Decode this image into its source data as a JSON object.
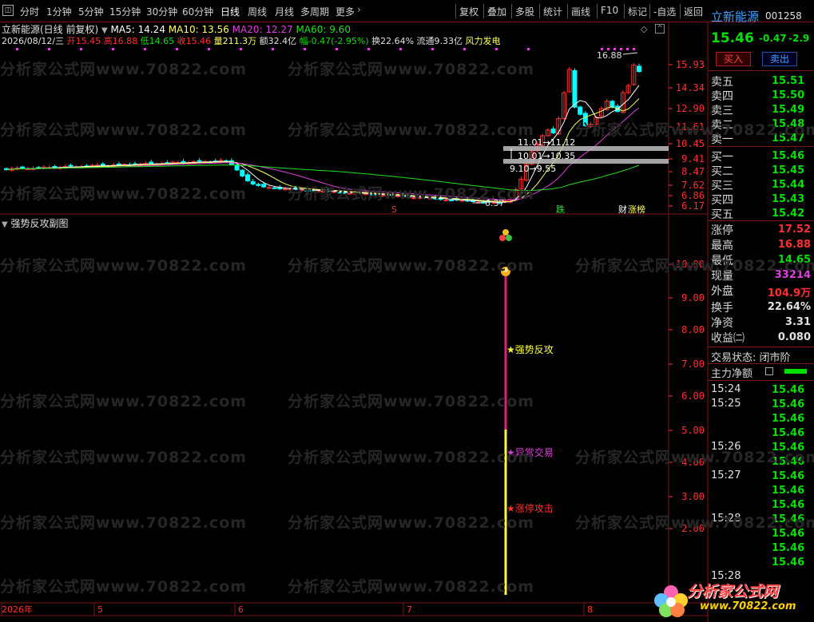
{
  "toolbar": {
    "tabs": [
      "分时",
      "1分钟",
      "5分钟",
      "15分钟",
      "30分钟",
      "60分钟",
      "日线",
      "周线",
      "月线",
      "多周期",
      "更多"
    ],
    "right": [
      "复权",
      "叠加",
      "多股",
      "统计",
      "画线",
      "F10",
      "标记",
      "-自选",
      "返回"
    ]
  },
  "stock": {
    "name": "立新能源",
    "code": "001258",
    "price": "15.46",
    "change": "-0.47",
    "pct": "-2.9"
  },
  "chart_header": {
    "title": "立新能源(日线 前复权)",
    "ma5": "MA5: 14.24",
    "ma10": "MA10: 13.56",
    "ma20": "MA20: 12.27",
    "ma60": "MA60: 9.60"
  },
  "info_line": [
    "2026/08/12/三",
    "开15.45",
    "高16.88",
    "低14.65",
    "收15.46",
    "量211.3万",
    "额32.4亿",
    "幅-0.47(-2.95%)",
    "换22.64%",
    "流通9.33亿",
    "风力发电"
  ],
  "main_axis": [
    "15.93",
    "14.34",
    "12.90",
    "11.61",
    "10.45",
    "9.41",
    "8.47",
    "7.62",
    "6.86",
    "6.17"
  ],
  "annotations": {
    "high": "16.88",
    "low": "6.37",
    "a1": "11.01→11.12",
    "a2": "10.01→10.35",
    "a3": "9.10→9.55",
    "mark_s": "S",
    "mark_die": "跌",
    "mark_cai": "财",
    "mark_zhang": "涨榜"
  },
  "subchart": {
    "title": "强势反攻副图",
    "axis": [
      "10.00",
      "9.00",
      "8.00",
      "7.00",
      "6.00",
      "5.00",
      "4.00",
      "3.00",
      "2.00"
    ],
    "label1": "强势反攻",
    "label2": "异常交易",
    "label3": "涨停攻击"
  },
  "dates": [
    "2026年",
    "5",
    "6",
    "7",
    "8"
  ],
  "right_panel": {
    "buy_btn": "买入",
    "sell_btn": "卖出",
    "asks": [
      {
        "label": "卖五",
        "price": "15.51"
      },
      {
        "label": "卖四",
        "price": "15.50"
      },
      {
        "label": "卖三",
        "price": "15.49"
      },
      {
        "label": "卖二",
        "price": "15.48"
      },
      {
        "label": "卖一",
        "price": "15.47"
      }
    ],
    "bids": [
      {
        "label": "买一",
        "price": "15.46"
      },
      {
        "label": "买二",
        "price": "15.45"
      },
      {
        "label": "买三",
        "price": "15.44"
      },
      {
        "label": "买四",
        "price": "15.43"
      },
      {
        "label": "买五",
        "price": "15.42"
      }
    ],
    "stats": [
      {
        "label": "涨停",
        "value": "17.52",
        "color": "#ff3030"
      },
      {
        "label": "最高",
        "value": "16.88",
        "color": "#ff3030"
      },
      {
        "label": "最低",
        "value": "14.65",
        "color": "#00e000"
      },
      {
        "label": "现量",
        "value": "33214",
        "color": "#e040e0"
      },
      {
        "label": "外盘",
        "value": "104.9万",
        "color": "#ff3030"
      },
      {
        "label": "换手",
        "value": "22.64%",
        "color": "#e0e0e0"
      },
      {
        "label": "净资",
        "value": "3.31",
        "color": "#e0e0e0"
      },
      {
        "label": "收益㈡",
        "value": "0.080",
        "color": "#e0e0e0"
      }
    ],
    "trade_state": "交易状态: 闭市阶",
    "main_net": "主力净额",
    "ticks": [
      {
        "time": "15:24",
        "price": "15.46"
      },
      {
        "time": "15:25",
        "price": "15.46"
      },
      {
        "time": "",
        "price": "15.46"
      },
      {
        "time": "",
        "price": "15.46"
      },
      {
        "time": "15:26",
        "price": "15.46"
      },
      {
        "time": "",
        "price": "15.46"
      },
      {
        "time": "15:27",
        "price": "15.46"
      },
      {
        "time": "",
        "price": "15.46"
      },
      {
        "time": "",
        "price": "15.46"
      },
      {
        "time": "15:28",
        "price": "15.46"
      },
      {
        "time": "",
        "price": "15.46"
      },
      {
        "time": "",
        "price": "15.46"
      },
      {
        "time": "",
        "price": "15.46"
      },
      {
        "time": "15:28",
        "price": ""
      }
    ]
  },
  "watermark": {
    "text": "分析家公式网www.70822.com",
    "logo": "分析家公式网",
    "logo_url": "www.70822.com"
  },
  "colors": {
    "up": "#ff3030",
    "down": "#00ffff",
    "ma5": "#ffffff",
    "ma10": "#ffff60",
    "ma20": "#e040e0",
    "ma60": "#20e020"
  }
}
